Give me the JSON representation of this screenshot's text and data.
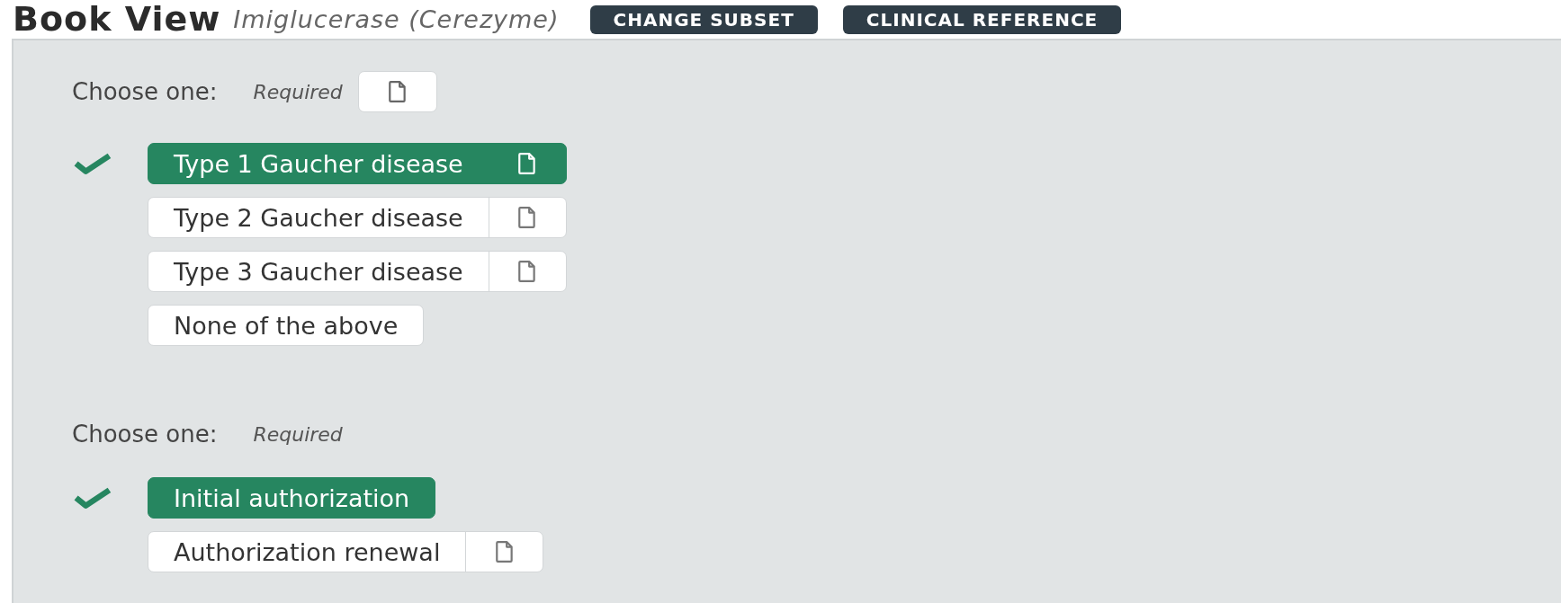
{
  "header": {
    "title": "Book View",
    "subtitle": "Imiglucerase (Cerezyme)",
    "buttons": [
      "CHANGE SUBSET",
      "CLINICAL REFERENCE"
    ]
  },
  "groups": [
    {
      "label": "Choose one:",
      "qualifier": "Required",
      "has_note": true,
      "options": [
        {
          "label": "Type 1 Gaucher disease",
          "selected": true,
          "has_note": true
        },
        {
          "label": "Type 2 Gaucher disease",
          "selected": false,
          "has_note": true
        },
        {
          "label": "Type 3 Gaucher disease",
          "selected": false,
          "has_note": true
        },
        {
          "label": "None of the above",
          "selected": false,
          "has_note": false
        }
      ]
    },
    {
      "label": "Choose one:",
      "qualifier": "Required",
      "has_note": false,
      "options": [
        {
          "label": "Initial authorization",
          "selected": true,
          "has_note": false
        },
        {
          "label": "Authorization renewal",
          "selected": false,
          "has_note": true
        }
      ]
    }
  ]
}
